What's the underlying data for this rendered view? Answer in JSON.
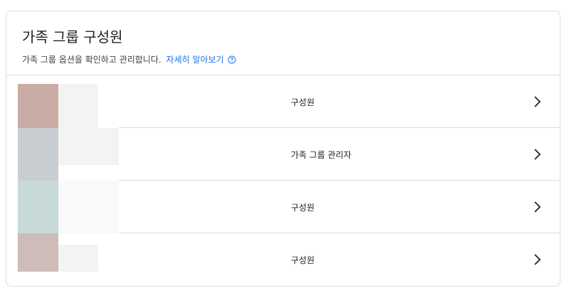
{
  "header": {
    "title": "가족 그룹 구성원",
    "subtitle": "가족 그룹 옵션을 확인하고 관리합니다.",
    "learn_more": "자세히 알아보기"
  },
  "members": [
    {
      "role": "구성원",
      "avatar_color": "#c9aca5",
      "name_color": "#f3f3f3"
    },
    {
      "role": "가족 그룹 관리자",
      "avatar_color": "#c8cdd1",
      "name_color": "#f3f3f3"
    },
    {
      "role": "구성원",
      "avatar_color": "#c7dad7",
      "name_color": "#f9f9f9"
    },
    {
      "role": "구성원",
      "avatar_color": "#cdbcb8",
      "name_color": "#f3f3f3"
    }
  ],
  "icons": {
    "help": "help-circle-icon",
    "chevron": "chevron-right-icon"
  },
  "colors": {
    "link": "#1a73e8",
    "border": "#dadce0",
    "text": "#202124"
  }
}
